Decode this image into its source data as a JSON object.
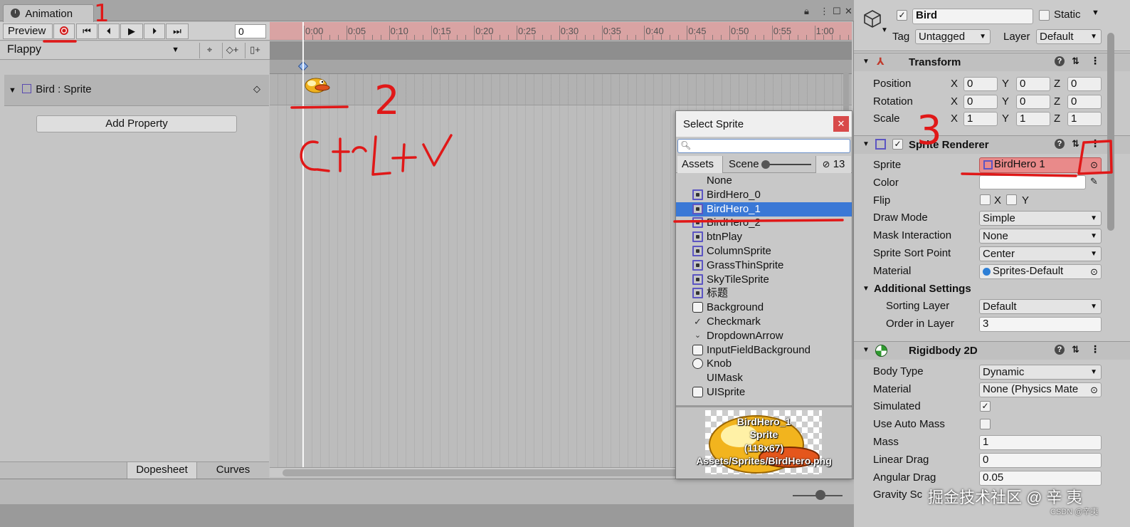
{
  "animation_window": {
    "tab_title": "Animation",
    "preview_label": "Preview",
    "frame_value": "0",
    "clip_name": "Flappy",
    "property_name": "Bird : Sprite",
    "add_property_label": "Add Property",
    "bottom_tabs": [
      "Dopesheet",
      "Curves"
    ],
    "time_labels": [
      "0:00",
      "0:05",
      "0:10",
      "0:15",
      "0:20",
      "0:25",
      "0:30",
      "0:35",
      "0:40",
      "0:45",
      "0:50",
      "0:55",
      "1:00"
    ]
  },
  "sprite_picker": {
    "title": "Select Sprite",
    "search_value": "",
    "tabs": [
      "Assets",
      "Scene"
    ],
    "hidden_count": "13",
    "items": [
      {
        "label": "None",
        "icon": "none"
      },
      {
        "label": "BirdHero_0",
        "icon": "sprite-icon"
      },
      {
        "label": "BirdHero_1",
        "icon": "sprite-icon",
        "selected": true
      },
      {
        "label": "BirdHero_2",
        "icon": "sprite-icon"
      },
      {
        "label": "btnPlay",
        "icon": "sprite-icon"
      },
      {
        "label": "ColumnSprite",
        "icon": "sprite-icon"
      },
      {
        "label": "GrassThinSprite",
        "icon": "sprite-icon"
      },
      {
        "label": "SkyTileSprite",
        "icon": "sprite-icon"
      },
      {
        "label": "标题",
        "icon": "sprite-icon"
      },
      {
        "label": "Background",
        "icon": "box-icon"
      },
      {
        "label": "Checkmark",
        "icon": "checkmark-icon"
      },
      {
        "label": "DropdownArrow",
        "icon": "chevron-down-icon"
      },
      {
        "label": "InputFieldBackground",
        "icon": "box-icon"
      },
      {
        "label": "Knob",
        "icon": "circle-icon"
      },
      {
        "label": "UIMask",
        "icon": "none"
      },
      {
        "label": "UISprite",
        "icon": "box-icon"
      }
    ],
    "preview": {
      "name": "BirdHero_1",
      "type": "Sprite",
      "size": "(118x67)",
      "path": "Assets/Sprites/BirdHero.png"
    }
  },
  "inspector": {
    "object_name": "Bird",
    "static_label": "Static",
    "tag_label": "Tag",
    "tag_value": "Untagged",
    "layer_label": "Layer",
    "layer_value": "Default",
    "transform": {
      "title": "Transform",
      "rows": [
        {
          "label": "Position",
          "x": "0",
          "y": "0",
          "z": "0"
        },
        {
          "label": "Rotation",
          "x": "0",
          "y": "0",
          "z": "0"
        },
        {
          "label": "Scale",
          "x": "1",
          "y": "1",
          "z": "1"
        }
      ]
    },
    "sprite_renderer": {
      "title": "Sprite Renderer",
      "sprite_label": "Sprite",
      "sprite_value": "BirdHero 1",
      "color_label": "Color",
      "flip_label": "Flip",
      "flip_x": "X",
      "flip_y": "Y",
      "draw_mode_label": "Draw Mode",
      "draw_mode_value": "Simple",
      "mask_label": "Mask Interaction",
      "mask_value": "None",
      "sort_point_label": "Sprite Sort Point",
      "sort_point_value": "Center",
      "material_label": "Material",
      "material_value": "Sprites-Default",
      "additional_label": "Additional Settings",
      "sorting_layer_label": "Sorting Layer",
      "sorting_layer_value": "Default",
      "order_label": "Order in Layer",
      "order_value": "3"
    },
    "rigidbody": {
      "title": "Rigidbody 2D",
      "body_type_label": "Body Type",
      "body_type_value": "Dynamic",
      "material_label": "Material",
      "material_value": "None (Physics Mate",
      "simulated_label": "Simulated",
      "auto_mass_label": "Use Auto Mass",
      "mass_label": "Mass",
      "mass_value": "1",
      "linear_drag_label": "Linear Drag",
      "linear_drag_value": "0",
      "angular_drag_label": "Angular Drag",
      "angular_drag_value": "0.05",
      "gravity_label": "Gravity Sc"
    }
  },
  "annotations": {
    "step1": "1",
    "step2": "2",
    "step3": "3",
    "note": "Ctrl+V"
  },
  "watermark": "掘金技术社区 @ 辛 夷",
  "csdn_mark": "CSDN @辛夷",
  "colors": {
    "record_red": "#d21b1b",
    "selection_blue": "#3a78d6",
    "annotation_red": "#e01818",
    "ruler_pink": "#d9a3a3"
  }
}
